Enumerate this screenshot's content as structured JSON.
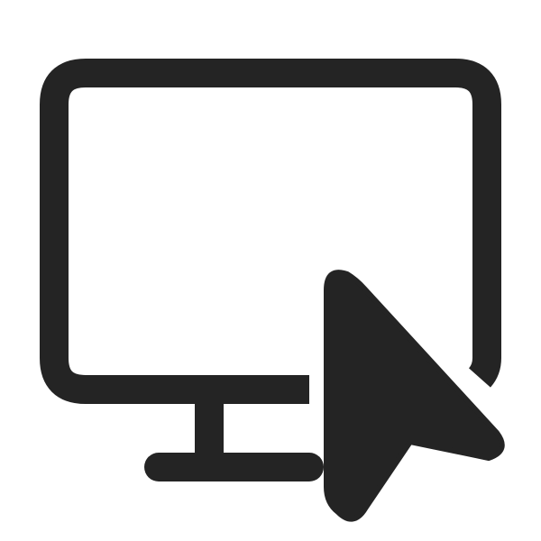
{
  "icon": {
    "name": "desktop-cursor-icon",
    "parts": [
      "monitor-screen",
      "monitor-stand",
      "mouse-pointer"
    ]
  },
  "colors": {
    "background": "#ffffff",
    "stroke": "#242424",
    "fill": "#242424"
  }
}
